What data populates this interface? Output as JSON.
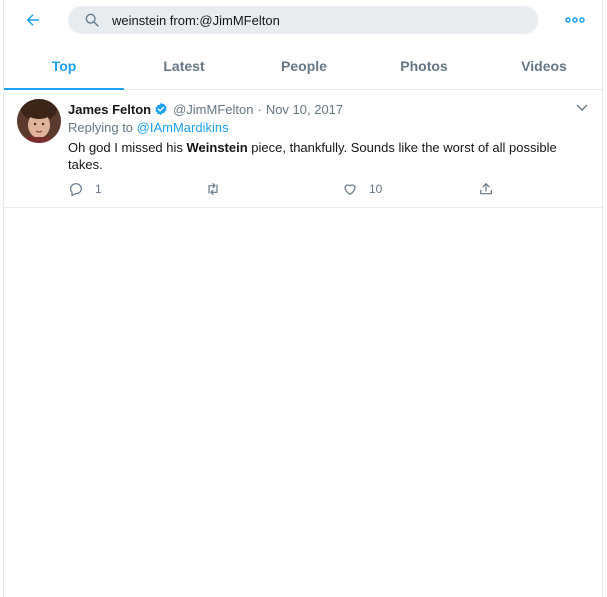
{
  "header": {
    "search_value": "weinstein from:@JimMFelton",
    "icons": {
      "back": "back-arrow-icon",
      "search": "search-icon",
      "more": "more-dots-icon"
    },
    "accent_color": "#1da1f2"
  },
  "tabs": [
    {
      "label": "Top",
      "active": true
    },
    {
      "label": "Latest",
      "active": false
    },
    {
      "label": "People",
      "active": false
    },
    {
      "label": "Photos",
      "active": false
    },
    {
      "label": "Videos",
      "active": false
    }
  ],
  "tweet": {
    "author_name": "James Felton",
    "verified": true,
    "handle": "@JimMFelton",
    "separator": "·",
    "date": "Nov 10, 2017",
    "replying_prefix": "Replying to",
    "replying_to": "@IAmMardikins",
    "text_before": "Oh god I missed his ",
    "text_highlight": "Weinstein",
    "text_after": " piece, thankfully. Sounds like the worst of all possible takes.",
    "reply_count": "1",
    "retweet_count": "",
    "like_count": "10"
  }
}
